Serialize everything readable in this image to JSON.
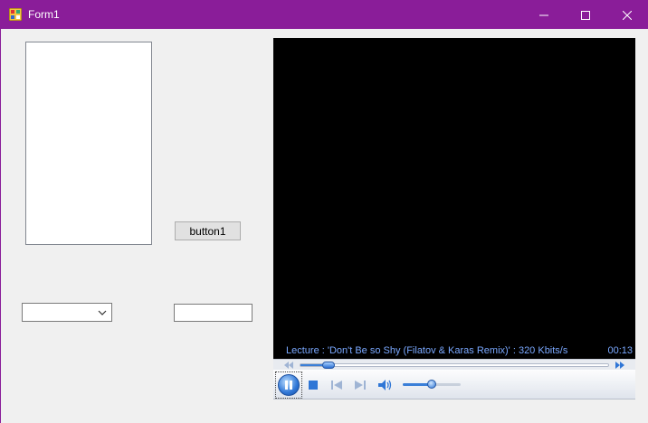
{
  "window": {
    "title": "Form1",
    "accent_color": "#8a1d99",
    "controls": {
      "minimize": "minimize-icon",
      "maximize": "maximize-icon",
      "close": "close-icon"
    }
  },
  "form": {
    "button1_label": "button1",
    "combobox_value": "",
    "textbox_value": ""
  },
  "media_player": {
    "status_text": "Lecture : 'Don't Be so Shy (Filatov & Karas Remix)' : 320 Kbits/s",
    "elapsed_time": "00:13",
    "seek_progress": 0.09,
    "volume_level": 0.5,
    "state": "playing",
    "status_color": "#7aa8ff"
  }
}
